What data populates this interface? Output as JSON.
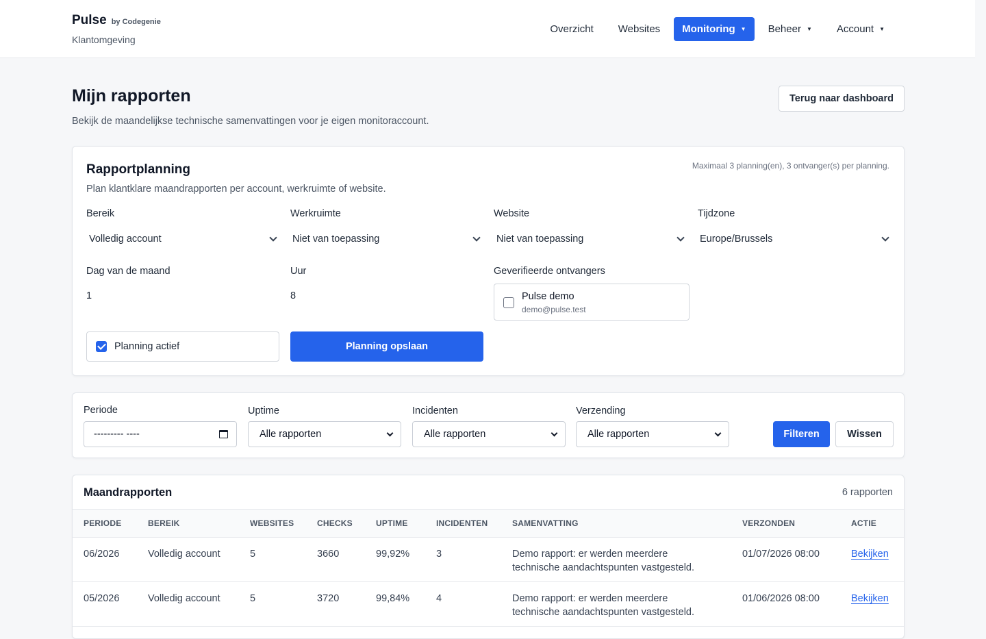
{
  "brand": {
    "name": "Pulse",
    "by": "by Codegenie",
    "subtitle": "Klantomgeving"
  },
  "nav": [
    {
      "label": "Overzicht",
      "dropdown": false,
      "active": false
    },
    {
      "label": "Websites",
      "dropdown": false,
      "active": false
    },
    {
      "label": "Monitoring",
      "dropdown": true,
      "active": true
    },
    {
      "label": "Beheer",
      "dropdown": true,
      "active": false
    },
    {
      "label": "Account",
      "dropdown": true,
      "active": false
    }
  ],
  "page": {
    "title": "Mijn rapporten",
    "subtitle": "Bekijk de maandelijkse technische samenvattingen voor je eigen monitoraccount.",
    "back_button": "Terug naar dashboard"
  },
  "planning": {
    "title": "Rapportplanning",
    "subtitle": "Plan klantklare maandrapporten per account, werkruimte of website.",
    "limit_note": "Maximaal 3 planning(en), 3 ontvanger(s) per planning.",
    "scope_label": "Bereik",
    "scope_value": "Volledig account",
    "workspace_label": "Werkruimte",
    "workspace_value": "Niet van toepassing",
    "website_label": "Website",
    "website_value": "Niet van toepassing",
    "timezone_label": "Tijdzone",
    "timezone_value": "Europe/Brussels",
    "day_label": "Dag van de maand",
    "day_value": "1",
    "hour_label": "Uur",
    "hour_value": "8",
    "recipients_label": "Geverifieerde ontvangers",
    "recipient_name": "Pulse demo",
    "recipient_email": "demo@pulse.test",
    "recipient_checked": false,
    "active_label": "Planning actief",
    "active_checked": true,
    "save_button": "Planning opslaan"
  },
  "filters": {
    "period_label": "Periode",
    "period_value": "--------- ----",
    "uptime_label": "Uptime",
    "uptime_value": "Alle rapporten",
    "incidents_label": "Incidenten",
    "incidents_value": "Alle rapporten",
    "delivery_label": "Verzending",
    "delivery_value": "Alle rapporten",
    "filter_button": "Filteren",
    "clear_button": "Wissen"
  },
  "reports": {
    "title": "Maandrapporten",
    "count": "6 rapporten",
    "columns": [
      "PERIODE",
      "BEREIK",
      "WEBSITES",
      "CHECKS",
      "UPTIME",
      "INCIDENTEN",
      "SAMENVATTING",
      "VERZONDEN",
      "ACTIE"
    ],
    "rows": [
      {
        "period": "06/2026",
        "scope": "Volledig account",
        "websites": "5",
        "checks": "3660",
        "uptime": "99,92%",
        "incidents": "3",
        "summary": "Demo rapport: er werden meerdere technische aandachtspunten vastgesteld.",
        "sent": "01/07/2026 08:00",
        "action": "Bekijken"
      },
      {
        "period": "05/2026",
        "scope": "Volledig account",
        "websites": "5",
        "checks": "3720",
        "uptime": "99,84%",
        "incidents": "4",
        "summary": "Demo rapport: er werden meerdere technische aandachtspunten vastgesteld.",
        "sent": "01/06/2026 08:00",
        "action": "Bekijken"
      }
    ]
  },
  "colors": {
    "accent": "#2563eb",
    "background": "#f6f7f9",
    "card": "#ffffff",
    "border": "#e2e5ea"
  }
}
